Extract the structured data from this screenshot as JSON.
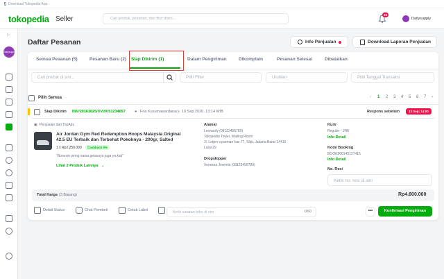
{
  "topbar": {
    "download": "Download Tokopedia App"
  },
  "header": {
    "logo": "tokopedia",
    "logo_sub": "Seller",
    "search_placeholder": "Cari produk, pesanan, dan fitur disini...",
    "notif_count": "33",
    "user": "Dailysupply"
  },
  "sidebar": {
    "store_initial": "Dailysupply"
  },
  "page": {
    "title": "Daftar Pesanan",
    "info_btn": "Info Penjualan",
    "download_btn": "Download Laporan Penjualan"
  },
  "tabs": [
    {
      "label": "Semua Pesanan (5)"
    },
    {
      "label": "Pesanan Baru (2)"
    },
    {
      "label": "Siap Dikirim (1)"
    },
    {
      "label": "Dalam Pengiriman"
    },
    {
      "label": "Dikomplain"
    },
    {
      "label": "Pesanan Selesai"
    },
    {
      "label": "Dibatalkan"
    }
  ],
  "filters": {
    "search": "Cari produk di sini...",
    "filter": "Pilih Filter",
    "sort": "Urutkan",
    "date": "Pilih Tanggal Transaksi"
  },
  "select_all": "Pilih Semua",
  "pager": [
    "1",
    "2",
    "3",
    "4",
    "5",
    "6",
    "7"
  ],
  "order": {
    "status": "Siap Dikirim",
    "invoice": "INV/20161025/XVI/X/51234657",
    "buyer": "Fria Kusumawardana",
    "date": "10 Sep 2020, 13:14 WIB",
    "respons_label": "Respons sebelum",
    "respons_due": "12 Sep; 14:00",
    "source": "Penjualan dari TopAds",
    "product_name": "Air Jordan Gym Red Redemption Hoops Malaysia Original 42.5 EU Terbaik dan Terbehat Pokoknya - 200gr, Salted",
    "qty_price": "1 x Rp2.250.000",
    "cashback": "Cashback 5%",
    "note": "\"Bonusin piring sama gelasnya juga ya kak\"",
    "more_products": "Lihat 2 Produk Lainnya",
    "alamat_label": "Alamat",
    "alamat": [
      "Leonardy (08123456789)",
      "Tokopedia Tower, Mailing Room",
      "Jl. Letjen s parman kav 77, Slipi, Jakarta Barat 14410",
      "Latai 29"
    ],
    "dropshipper_label": "Dropshipper",
    "dropshipper": "Venessa Jeremia (08123456789)",
    "kurir_label": "Kurir",
    "kurir": "Reguler - JNE",
    "info_detail": "Info Detail",
    "booking_label": "Kode Booking",
    "booking": "BOOE900142127415",
    "resi_label": "No. Resi",
    "resi_placeholder": "Ketik no. resi di sini",
    "total_label": "Total Harga",
    "total_items": "(3 Barang)",
    "total": "Rp4.800.000"
  },
  "footer": {
    "detail": "Detail Status",
    "chat": "Chat Pembeli",
    "print": "Cetak Label",
    "note_placeholder": "Ketik catatan toko di sini",
    "count": "0/60",
    "more": "•••",
    "confirm": "Konfirmasi Pengiriman"
  }
}
